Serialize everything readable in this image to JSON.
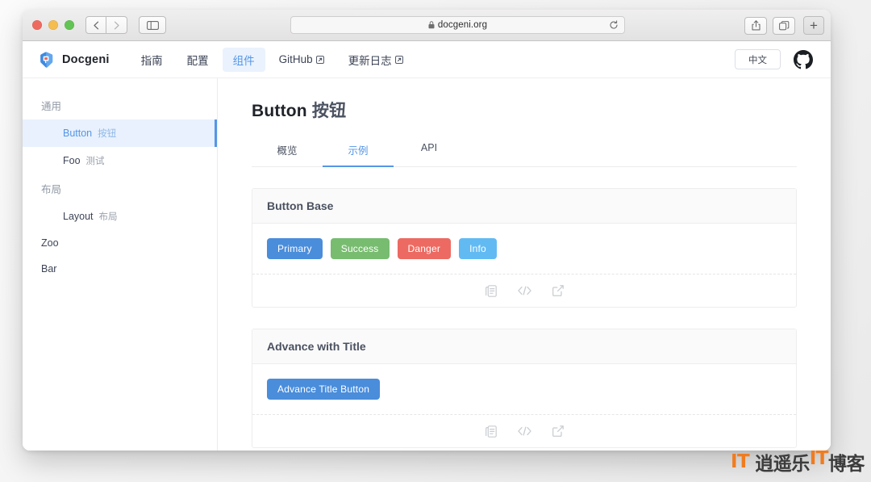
{
  "browser": {
    "url": "docgeni.org",
    "lock_icon": "lock-icon",
    "reload_icon": "reload-icon",
    "back_icon": "back-chevron-icon",
    "forward_icon": "forward-chevron-icon",
    "sidebar_toggle_icon": "sidebar-toggle-icon",
    "share_icon": "share-icon",
    "tabs_icon": "tab-overview-icon",
    "new_tab_label": "+"
  },
  "site_header": {
    "brand": "Docgeni",
    "logo_icon": "docgeni-logo-icon",
    "nav": [
      {
        "label": "指南",
        "external": false,
        "active": false
      },
      {
        "label": "配置",
        "external": false,
        "active": false
      },
      {
        "label": "组件",
        "external": false,
        "active": true
      },
      {
        "label": "GitHub",
        "external": true,
        "active": false
      },
      {
        "label": "更新日志",
        "external": true,
        "active": false
      }
    ],
    "language": "中文",
    "github_icon": "github-icon",
    "external_icon": "external-link-icon"
  },
  "sidebar": {
    "sections": [
      {
        "title": "通用",
        "items": [
          {
            "label": "Button",
            "cn": "按钮",
            "active": true
          },
          {
            "label": "Foo",
            "cn": "测试",
            "active": false
          }
        ]
      },
      {
        "title": "布局",
        "items": [
          {
            "label": "Layout",
            "cn": "布局",
            "active": false
          }
        ]
      }
    ],
    "standalone": [
      {
        "label": "Zoo",
        "active": false
      },
      {
        "label": "Bar",
        "active": false
      }
    ]
  },
  "main": {
    "title_en": "Button",
    "title_cn": "按钮",
    "tabs": [
      {
        "label": "概览",
        "active": false
      },
      {
        "label": "示例",
        "active": true
      },
      {
        "label": "API",
        "active": false
      }
    ],
    "examples": [
      {
        "title": "Button Base",
        "buttons": [
          {
            "label": "Primary",
            "color": "#4a8ddb"
          },
          {
            "label": "Success",
            "color": "#78bc70"
          },
          {
            "label": "Danger",
            "color": "#ec6a62"
          },
          {
            "label": "Info",
            "color": "#62baf3"
          }
        ],
        "actions": [
          {
            "icon": "copy-icon"
          },
          {
            "icon": "code-icon",
            "glyph": "</>"
          },
          {
            "icon": "open-external-icon"
          }
        ]
      },
      {
        "title": "Advance with Title",
        "buttons": [
          {
            "label": "Advance Title Button",
            "color": "#4a8ddb"
          }
        ],
        "actions": [
          {
            "icon": "copy-icon"
          },
          {
            "icon": "code-icon",
            "glyph": "</>"
          },
          {
            "icon": "open-external-icon"
          }
        ]
      }
    ]
  },
  "watermark": {
    "prefix": "IT",
    "text_1": "逍遥乐",
    "text_2": "IT",
    "text_3": "博客"
  },
  "colors": {
    "accent": "#5596e6",
    "primary": "#4a8ddb",
    "success": "#78bc70",
    "danger": "#ec6a62",
    "info": "#62baf3",
    "active_bg": "#e8f1fd",
    "watermark_orange": "#f07c20"
  }
}
